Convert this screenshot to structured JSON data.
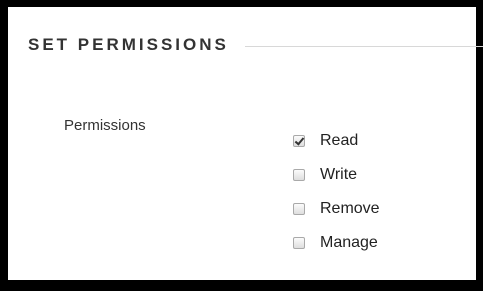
{
  "section": {
    "title": "SET PERMISSIONS"
  },
  "permissions": {
    "label": "Permissions",
    "options": [
      {
        "label": "Read",
        "checked": true
      },
      {
        "label": "Write",
        "checked": false
      },
      {
        "label": "Remove",
        "checked": false
      },
      {
        "label": "Manage",
        "checked": false
      }
    ]
  }
}
